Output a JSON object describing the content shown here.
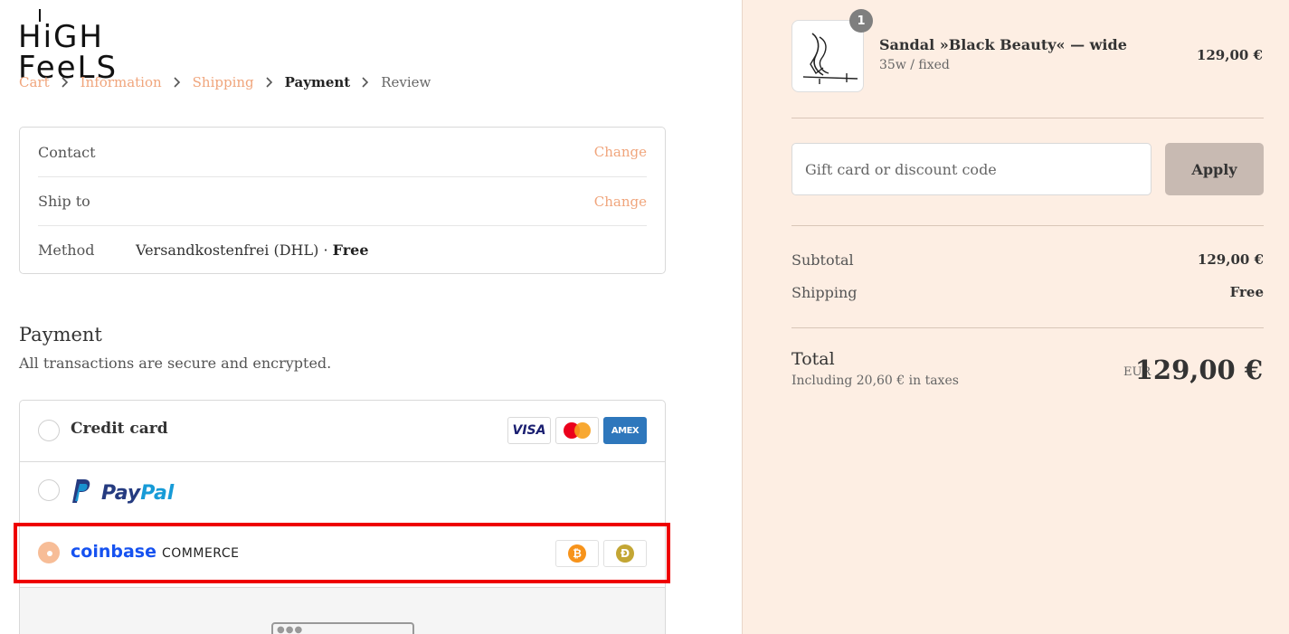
{
  "brand": {
    "logo_text": "HiGH FeeLS"
  },
  "breadcrumb": [
    {
      "label": "Cart"
    },
    {
      "label": "Information"
    },
    {
      "label": "Shipping"
    },
    {
      "label": "Payment"
    },
    {
      "label": "Review"
    }
  ],
  "review": {
    "contact": {
      "label": "Contact",
      "change": "Change"
    },
    "ship_to": {
      "label": "Ship to",
      "change": "Change"
    },
    "method": {
      "label": "Method",
      "value": "Versandkostenfrei (DHL) · ",
      "value_strong": "Free"
    }
  },
  "payment": {
    "title": "Payment",
    "subtitle": "All transactions are secure and encrypted.",
    "options": {
      "credit_card": {
        "label": "Credit card",
        "cards": [
          "VISA",
          "AMEX"
        ]
      },
      "paypal": {
        "label_p1": "Pay",
        "label_p2": "Pal"
      },
      "coinbase": {
        "name": "coinbase",
        "suffix": "COMMERCE",
        "coins": [
          "₿",
          "Ð"
        ]
      }
    }
  },
  "summary": {
    "item": {
      "quantity": "1",
      "name": "Sandal »Black Beauty« — wide",
      "variant": "35w / fixed",
      "price": "129,00 €"
    },
    "discount": {
      "placeholder": "Gift card or discount code",
      "apply_label": "Apply"
    },
    "subtotal": {
      "label": "Subtotal",
      "value": "129,00 €"
    },
    "shipping": {
      "label": "Shipping",
      "value": "Free"
    },
    "total": {
      "label": "Total",
      "tax_note": "Including 20,60 € in taxes",
      "currency": "EUR",
      "value": "129,00 €"
    }
  },
  "colors": {
    "accent": "#f0a57c",
    "summary_bg": "#fdeee3",
    "highlight": "#ee0000",
    "coinbase_blue": "#1652f0"
  }
}
